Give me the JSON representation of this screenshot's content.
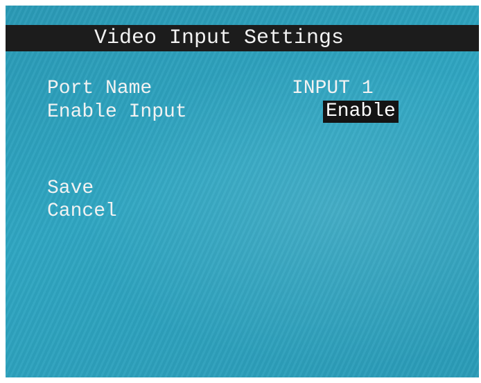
{
  "osd": {
    "title": "Video Input Settings",
    "fields": {
      "port_name_label": "Port Name",
      "port_name_value": "INPUT 1",
      "enable_input_label": "Enable Input",
      "enable_input_value": "Enable"
    },
    "actions": {
      "save_label": "Save",
      "cancel_label": "Cancel"
    },
    "colors": {
      "background": "#2fa6c2",
      "title_bar": "#1c1c1c",
      "text": "#f2f2f2",
      "selection_highlight": "#141414"
    }
  }
}
